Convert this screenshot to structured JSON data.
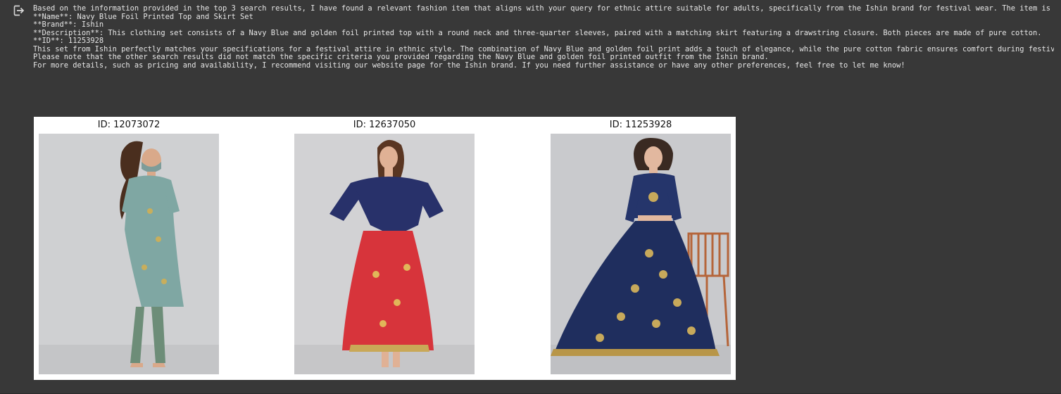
{
  "output": {
    "icon": "output-redirect-icon",
    "lines": [
      "Based on the information provided in the top 3 search results, I have found a relevant fashion item that aligns with your query for ethnic attire suitable for adults, specifically from the Ishin brand for festival wear. The item is described as:",
      "**Name**: Navy Blue Foil Printed Top and Skirt Set",
      "**Brand**: Ishin",
      "**Description**: This clothing set consists of a Navy Blue and golden foil printed top with a round neck and three-quarter sleeves, paired with a matching skirt featuring a drawstring closure. Both pieces are made of pure cotton.",
      "**ID**: 11253928",
      "This set from Ishin perfectly matches your specifications for a festival attire in ethnic style. The combination of Navy Blue and golden foil print adds a touch of elegance, while the pure cotton fabric ensures comfort during festivities.",
      "Please note that the other search results did not match the specific criteria you provided regarding the Navy Blue and golden foil printed outfit from the Ishin brand.",
      "For more details, such as pricing and availability, I recommend visiting our website page for the Ishin brand. If you need further assistance or have any other preferences, feel free to let me know!"
    ]
  },
  "figure": {
    "panels": [
      {
        "title": "ID: 12073072",
        "image": "teal-kurta-palazzo-photo"
      },
      {
        "title": "ID: 12637050",
        "image": "navy-top-red-skirt-photo"
      },
      {
        "title": "ID: 11253928",
        "image": "navy-foil-top-skirt-photo"
      }
    ]
  },
  "colors": {
    "background": "#383838",
    "text": "#e6e6e6",
    "figure_bg": "#ffffff"
  }
}
